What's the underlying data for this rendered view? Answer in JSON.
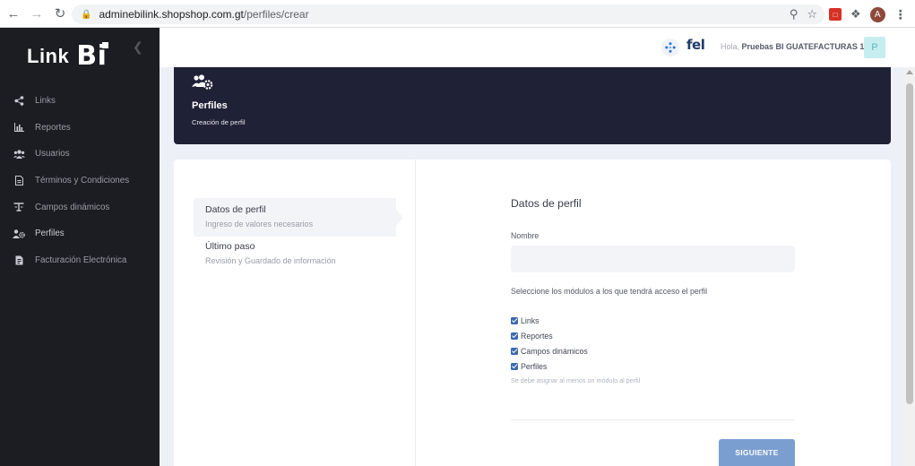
{
  "browser": {
    "url_host": "adminebilink.shopshop.com.gt",
    "url_path": "/perfiles/crear",
    "profile_initial": "A"
  },
  "sidebar": {
    "logo_text": "Link",
    "logo_mark": "Bi",
    "items": [
      {
        "label": "Links",
        "icon": "share-icon"
      },
      {
        "label": "Reportes",
        "icon": "bar-chart-icon"
      },
      {
        "label": "Usuarios",
        "icon": "users-icon"
      },
      {
        "label": "Términos y Condiciones",
        "icon": "document-icon"
      },
      {
        "label": "Campos dinámicos",
        "icon": "text-fields-icon"
      },
      {
        "label": "Perfiles",
        "icon": "user-gear-icon"
      },
      {
        "label": "Facturación Electrónica",
        "icon": "invoice-icon"
      }
    ]
  },
  "header": {
    "brand": "fel",
    "greeting_prefix": "Hola,",
    "user_name": "Pruebas BI GUATEFACTURAS 1",
    "avatar_initial": "P"
  },
  "hero": {
    "title": "Perfiles",
    "subtitle": "Creación de perfil"
  },
  "steps": [
    {
      "title": "Datos de perfil",
      "desc": "Ingreso de valores necesarios"
    },
    {
      "title": "Último paso",
      "desc": "Revisión y Guardado de información"
    }
  ],
  "form": {
    "title": "Datos de perfil",
    "name_label": "Nombre",
    "name_value": "",
    "modules_label": "Seleccione los módulos a los que tendrá acceso el perfil",
    "modules": [
      {
        "label": "Links",
        "checked": true
      },
      {
        "label": "Reportes",
        "checked": true
      },
      {
        "label": "Campos dinámicos",
        "checked": true
      },
      {
        "label": "Perfiles",
        "checked": true
      }
    ],
    "hint": "Se debe asignar al menos un módulo al perfil",
    "next_button": "SIGUIENTE"
  },
  "colors": {
    "sidebar_bg": "#1c1d23",
    "hero_bg": "#1f2136",
    "primary_button": "#7b9ed0",
    "checkbox": "#3d6ab0"
  }
}
